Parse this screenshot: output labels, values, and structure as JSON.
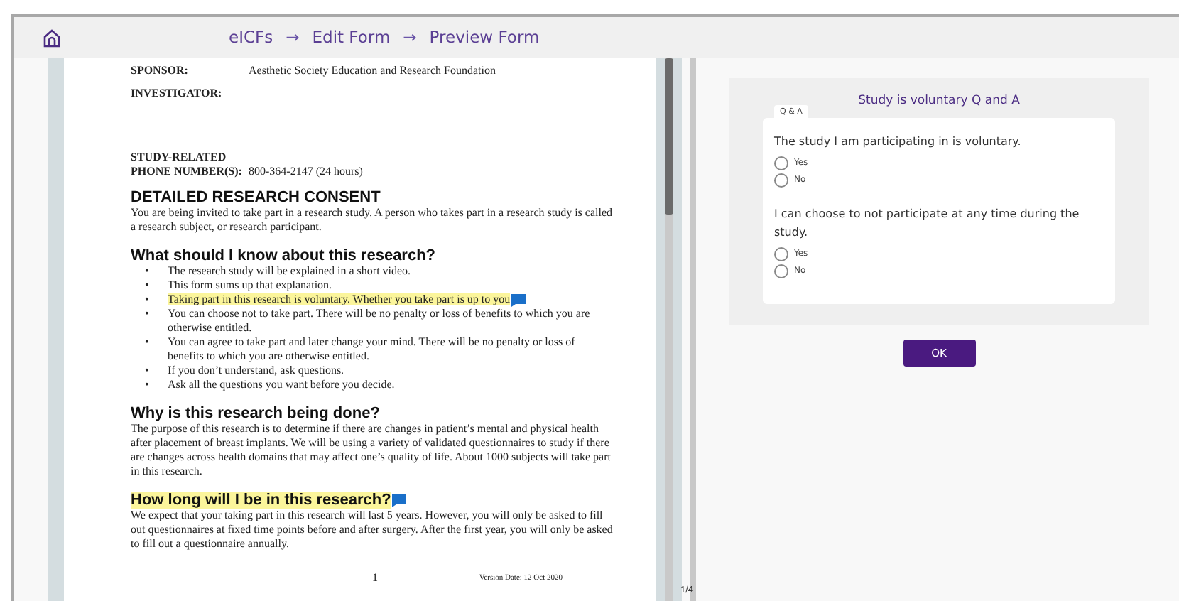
{
  "breadcrumb": [
    {
      "kind": "link",
      "text": "eICFs"
    },
    {
      "kind": "separator",
      "text": "→"
    },
    {
      "kind": "link",
      "text": "Edit Form"
    },
    {
      "kind": "separator",
      "text": "→"
    },
    {
      "kind": "link",
      "text": "Preview Form"
    }
  ],
  "document": {
    "blocks": [
      {
        "kind": "field",
        "label": "SPONSOR:",
        "value": "Aesthetic Society Education and Research Foundation"
      },
      {
        "kind": "field",
        "label": "INVESTIGATOR:"
      },
      {
        "kind": "field2",
        "label": "STUDY-RELATED",
        "label2": "PHONE NUMBER(S):",
        "value": "800-364-2147 (24 hours)"
      },
      {
        "kind": "heading",
        "text": "DETAILED RESEARCH CONSENT",
        "highlighted": false
      },
      {
        "kind": "paragraph",
        "text": "You are being invited to take part in a research study.  A person who takes part in a research study is called a research subject, or research participant."
      },
      {
        "kind": "heading",
        "text": "What should I know about this research?",
        "highlighted": false
      },
      {
        "kind": "bullets",
        "marker": "•",
        "items": [
          {
            "text": "The research study will be explained in a short video.",
            "highlighted": false
          },
          {
            "text": "This form sums up that explanation.",
            "highlighted": false
          },
          {
            "text": "Taking part in this research is voluntary. Whether you take part is up to you",
            "highlighted": true
          },
          {
            "text": "You can choose not to take part. There will be no penalty or loss of benefits to which you are otherwise entitled.",
            "highlighted": false
          },
          {
            "text": "You can agree to take part and later change your mind. There will be no penalty or loss of benefits to which you are otherwise entitled.",
            "highlighted": false
          },
          {
            "text": "If you don’t understand, ask questions.",
            "highlighted": false
          },
          {
            "text": "Ask all the questions you want before you decide.",
            "highlighted": false
          }
        ]
      },
      {
        "kind": "heading",
        "text": "Why is this research being done?",
        "highlighted": false
      },
      {
        "kind": "paragraph",
        "text": "The purpose of this research is to determine if there are changes in patient’s mental and physical health after placement of breast implants. We will be using a variety of validated questionnaires to study if there are changes across health domains that may affect one’s quality of life. About 1000 subjects will take part in this research."
      },
      {
        "kind": "heading",
        "text": "How long will I be in this research?",
        "highlighted": true
      },
      {
        "kind": "paragraph",
        "text": "We expect that your taking part in this research will last 5 years. However, you will only be asked to fill out questionnaires at fixed time points before and after surgery. After the first year, you will only be asked to fill out a questionnaire annually."
      }
    ],
    "page_number": "1",
    "version": "Version Date: 12 Oct 2020",
    "page_counter": "1/4"
  },
  "form": {
    "title": "Study is voluntary Q and A",
    "group_label": "Q & A",
    "questions": [
      {
        "text": "The study I am participating in is voluntary.",
        "options": [
          {
            "label": "Yes",
            "selected": false
          },
          {
            "label": "No",
            "selected": false
          }
        ]
      },
      {
        "text": "I can choose to not participate at any time during the study.",
        "options": [
          {
            "label": "Yes",
            "selected": false
          },
          {
            "label": "No",
            "selected": false
          }
        ]
      }
    ],
    "button": "OK"
  }
}
